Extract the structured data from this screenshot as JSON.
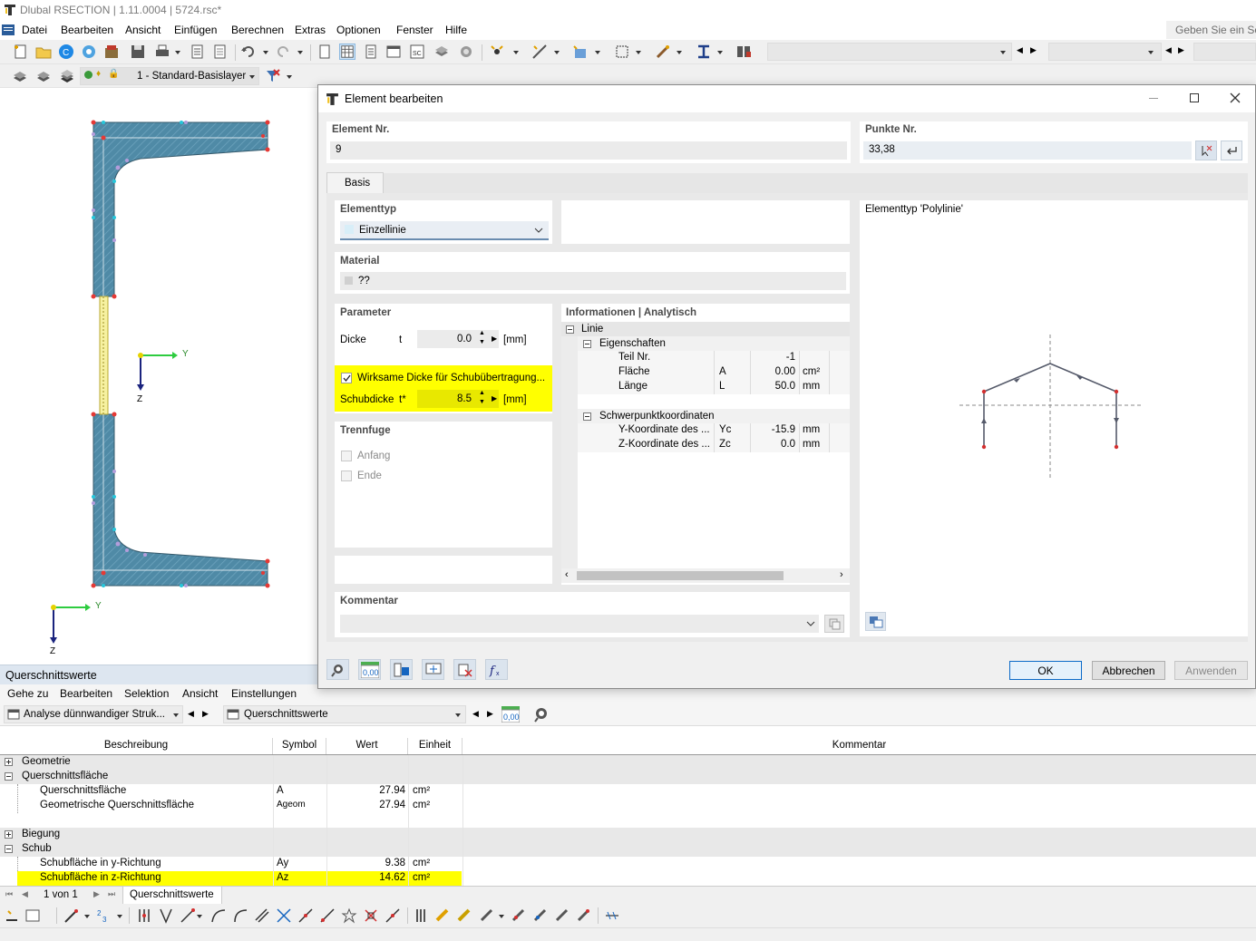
{
  "app": {
    "title": "Dlubal RSECTION | 1.11.0004 | 5724.rsc*"
  },
  "menu": [
    "Datei",
    "Bearbeiten",
    "Ansicht",
    "Einfügen",
    "Berechnen",
    "Extras",
    "Optionen",
    "Fenster",
    "Hilfe"
  ],
  "help_search_placeholder": "Geben Sie ein Sch",
  "layer": {
    "name": "1 - Standard-Basislayer"
  },
  "drawing": {
    "axis_y": "Y",
    "axis_z": "Z"
  },
  "dialog": {
    "title": "Element bearbeiten",
    "element_nr_label": "Element Nr.",
    "element_nr_value": "9",
    "punkte_nr_label": "Punkte Nr.",
    "punkte_nr_value": "33,38",
    "tab_basis": "Basis",
    "elementtyp_label": "Elementtyp",
    "elementtyp_value": "Einzellinie",
    "material_label": "Material",
    "material_value": "??",
    "parameter_label": "Parameter",
    "dicke_label": "Dicke",
    "dicke_symbol": "t",
    "dicke_value": "0.0",
    "dicke_unit": "[mm]",
    "wirksame_label": "Wirksame Dicke für Schubübertragung...",
    "wirksame_checked": true,
    "schubdicke_label": "Schubdicke",
    "schubdicke_symbol": "t*",
    "schubdicke_value": "8.5",
    "schubdicke_unit": "[mm]",
    "trennfuge_label": "Trennfuge",
    "anfang_label": "Anfang",
    "ende_label": "Ende",
    "info_label": "Informationen | Analytisch",
    "info_tree": {
      "linie": "Linie",
      "eigenschaften": "Eigenschaften",
      "teil_nr_label": "Teil Nr.",
      "teil_nr_value": "-1",
      "flaeche_label": "Fläche",
      "flaeche_symbol": "A",
      "flaeche_value": "0.00",
      "flaeche_unit": "cm²",
      "laenge_label": "Länge",
      "laenge_symbol": "L",
      "laenge_value": "50.0",
      "laenge_unit": "mm",
      "schwerpunkt": "Schwerpunktkoordinaten",
      "y_koord_label": "Y-Koordinate des ...",
      "y_koord_symbol": "Yc",
      "y_koord_value": "-15.9",
      "y_koord_unit": "mm",
      "z_koord_label": "Z-Koordinate des ...",
      "z_koord_symbol": "Zc",
      "z_koord_value": "0.0",
      "z_koord_unit": "mm"
    },
    "preview_label": "Elementtyp 'Polylinie'",
    "kommentar_label": "Kommentar",
    "ok": "OK",
    "abbrechen": "Abbrechen",
    "anwenden": "Anwenden"
  },
  "qs": {
    "title": "Querschnittswerte",
    "menu": [
      "Gehe zu",
      "Bearbeiten",
      "Selektion",
      "Ansicht",
      "Einstellungen"
    ],
    "analysis_combo": "Analyse dünnwandiger Struk...",
    "values_combo": "Querschnittswerte",
    "columns": [
      "Beschreibung",
      "Symbol",
      "Wert",
      "Einheit",
      "Kommentar"
    ],
    "groups": {
      "geometrie": "Geometrie",
      "querschnittsflaeche": "Querschnittsfläche",
      "biegung": "Biegung",
      "schub": "Schub"
    },
    "rows": [
      {
        "desc": "Querschnittsfläche",
        "sym": "A",
        "val": "27.94",
        "unit": "cm²"
      },
      {
        "desc": "Geometrische Querschnittsfläche",
        "sym": "Ageom",
        "val": "27.94",
        "unit": "cm²"
      },
      {
        "desc": "Schubfläche in y-Richtung",
        "sym": "Ay",
        "val": "9.38",
        "unit": "cm²"
      },
      {
        "desc": "Schubfläche in z-Richtung",
        "sym": "Az",
        "val": "14.62",
        "unit": "cm²"
      }
    ],
    "page": "1 von 1",
    "tab": "Querschnittswerte"
  },
  "colors": {
    "highlight": "#ffff00",
    "section_fill": "#4f8aa6",
    "accent": "#0b6ac8"
  }
}
